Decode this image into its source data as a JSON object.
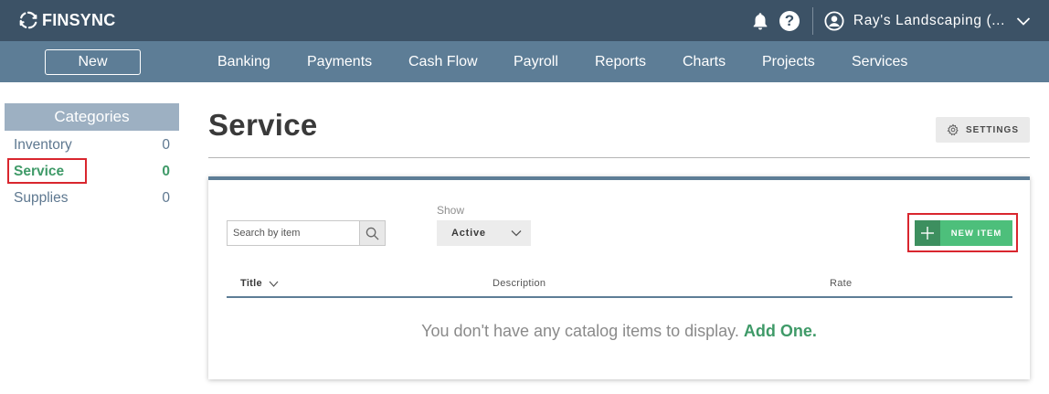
{
  "brand": {
    "name": "FINSYNC"
  },
  "header": {
    "company_name": "Ray's Landscaping (..."
  },
  "nav": {
    "new_label": "New",
    "items": [
      "Banking",
      "Payments",
      "Cash Flow",
      "Payroll",
      "Reports",
      "Charts",
      "Projects",
      "Services"
    ]
  },
  "sidebar": {
    "heading": "Categories",
    "categories": [
      {
        "label": "Inventory",
        "count": "0"
      },
      {
        "label": "Service",
        "count": "0"
      },
      {
        "label": "Supplies",
        "count": "0"
      }
    ]
  },
  "main": {
    "title": "Service",
    "settings_label": "SETTINGS",
    "search_placeholder": "Search by item",
    "show_label": "Show",
    "show_value": "Active",
    "new_item_label": "NEW ITEM",
    "columns": [
      "Title",
      "Description",
      "Rate"
    ],
    "empty_message": "You don't have any catalog items to display.",
    "add_one_label": "Add One."
  },
  "colors": {
    "topbar": "#3c5266",
    "navbar": "#5d7d96",
    "accent_green": "#4dbf7b",
    "highlight_red": "#d9262e"
  }
}
